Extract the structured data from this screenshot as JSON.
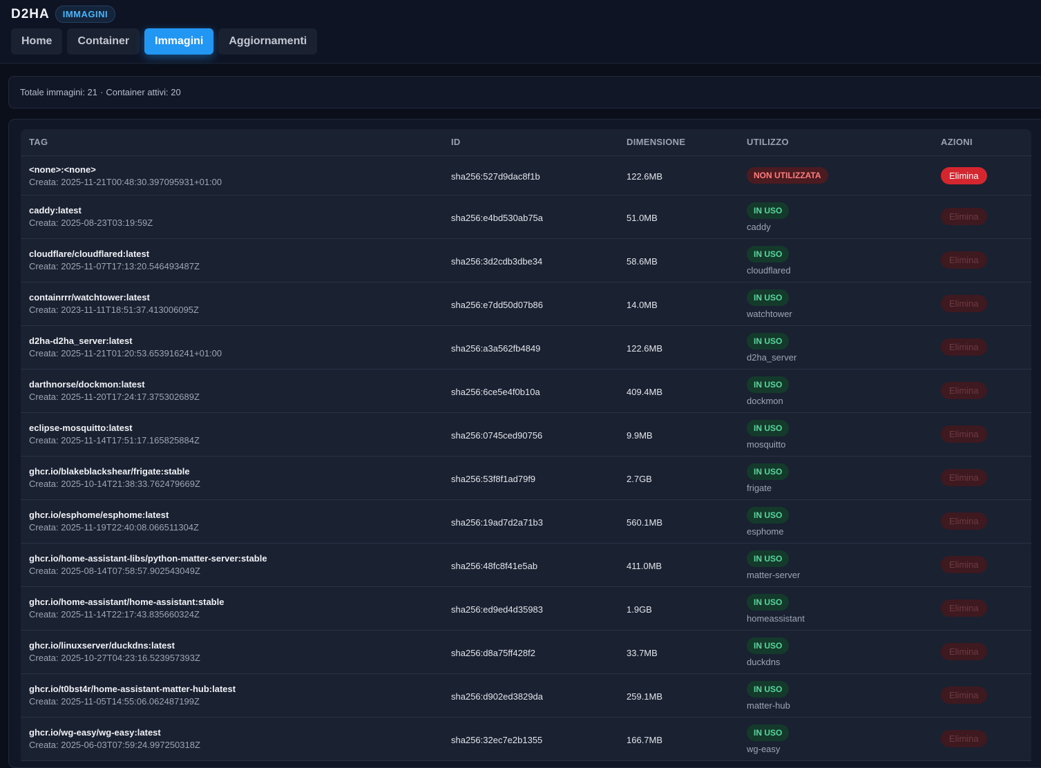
{
  "brand": {
    "name": "D2HA",
    "section_badge": "IMMAGINI"
  },
  "tabs": [
    {
      "label": "Home"
    },
    {
      "label": "Container"
    },
    {
      "label": "Immagini"
    },
    {
      "label": "Aggiornamenti"
    }
  ],
  "summary": {
    "total_images_label": "Totale immagini: 21",
    "separator": "·",
    "active_containers_label": "Container attivi: 20"
  },
  "table": {
    "columns": [
      "TAG",
      "ID",
      "DIMENSIONE",
      "UTILIZZO",
      "AZIONI"
    ],
    "rows": [
      {
        "tag": "<none>:<none>",
        "created": "Creata: 2025-11-21T00:48:30.397095931+01:00",
        "id": "sha256:527d9dac8f1b",
        "size": "122.6MB",
        "usage": "NON UTILIZZATA",
        "container": "",
        "action": "Elimina"
      },
      {
        "tag": "caddy:latest",
        "created": "Creata: 2025-08-23T03:19:59Z",
        "id": "sha256:e4bd530ab75a",
        "size": "51.0MB",
        "usage": "IN USO",
        "container": "caddy",
        "action": "Elimina"
      },
      {
        "tag": "cloudflare/cloudflared:latest",
        "created": "Creata: 2025-11-07T17:13:20.546493487Z",
        "id": "sha256:3d2cdb3dbe34",
        "size": "58.6MB",
        "usage": "IN USO",
        "container": "cloudflared",
        "action": "Elimina"
      },
      {
        "tag": "containrrr/watchtower:latest",
        "created": "Creata: 2023-11-11T18:51:37.413006095Z",
        "id": "sha256:e7dd50d07b86",
        "size": "14.0MB",
        "usage": "IN USO",
        "container": "watchtower",
        "action": "Elimina"
      },
      {
        "tag": "d2ha-d2ha_server:latest",
        "created": "Creata: 2025-11-21T01:20:53.653916241+01:00",
        "id": "sha256:a3a562fb4849",
        "size": "122.6MB",
        "usage": "IN USO",
        "container": "d2ha_server",
        "action": "Elimina"
      },
      {
        "tag": "darthnorse/dockmon:latest",
        "created": "Creata: 2025-11-20T17:24:17.375302689Z",
        "id": "sha256:6ce5e4f0b10a",
        "size": "409.4MB",
        "usage": "IN USO",
        "container": "dockmon",
        "action": "Elimina"
      },
      {
        "tag": "eclipse-mosquitto:latest",
        "created": "Creata: 2025-11-14T17:51:17.165825884Z",
        "id": "sha256:0745ced90756",
        "size": "9.9MB",
        "usage": "IN USO",
        "container": "mosquitto",
        "action": "Elimina"
      },
      {
        "tag": "ghcr.io/blakeblackshear/frigate:stable",
        "created": "Creata: 2025-10-14T21:38:33.762479669Z",
        "id": "sha256:53f8f1ad79f9",
        "size": "2.7GB",
        "usage": "IN USO",
        "container": "frigate",
        "action": "Elimina"
      },
      {
        "tag": "ghcr.io/esphome/esphome:latest",
        "created": "Creata: 2025-11-19T22:40:08.066511304Z",
        "id": "sha256:19ad7d2a71b3",
        "size": "560.1MB",
        "usage": "IN USO",
        "container": "esphome",
        "action": "Elimina"
      },
      {
        "tag": "ghcr.io/home-assistant-libs/python-matter-server:stable",
        "created": "Creata: 2025-08-14T07:58:57.902543049Z",
        "id": "sha256:48fc8f41e5ab",
        "size": "411.0MB",
        "usage": "IN USO",
        "container": "matter-server",
        "action": "Elimina"
      },
      {
        "tag": "ghcr.io/home-assistant/home-assistant:stable",
        "created": "Creata: 2025-11-14T22:17:43.835660324Z",
        "id": "sha256:ed9ed4d35983",
        "size": "1.9GB",
        "usage": "IN USO",
        "container": "homeassistant",
        "action": "Elimina"
      },
      {
        "tag": "ghcr.io/linuxserver/duckdns:latest",
        "created": "Creata: 2025-10-27T04:23:16.523957393Z",
        "id": "sha256:d8a75ff428f2",
        "size": "33.7MB",
        "usage": "IN USO",
        "container": "duckdns",
        "action": "Elimina"
      },
      {
        "tag": "ghcr.io/t0bst4r/home-assistant-matter-hub:latest",
        "created": "Creata: 2025-11-05T14:55:06.062487199Z",
        "id": "sha256:d902ed3829da",
        "size": "259.1MB",
        "usage": "IN USO",
        "container": "matter-hub",
        "action": "Elimina"
      },
      {
        "tag": "ghcr.io/wg-easy/wg-easy:latest",
        "created": "Creata: 2025-06-03T07:59:24.997250318Z",
        "id": "sha256:32ec7e2b1355",
        "size": "166.7MB",
        "usage": "IN USO",
        "container": "wg-easy",
        "action": "Elimina"
      }
    ]
  },
  "colors": {
    "background": "#0b0f19",
    "accent": "#2196f3",
    "in_use": "#58d79c",
    "unused": "#ff7d7d",
    "delete": "#d3262e"
  }
}
